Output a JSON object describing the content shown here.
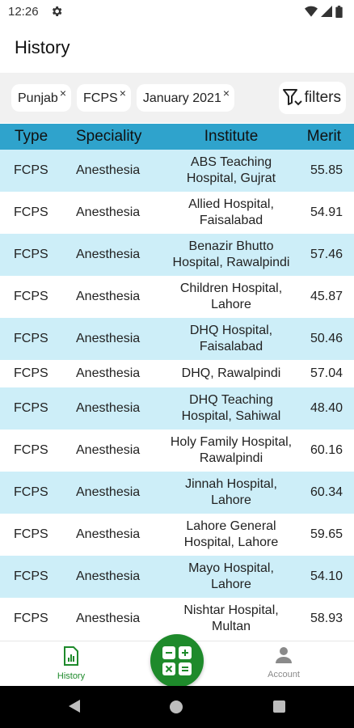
{
  "status_bar": {
    "time": "12:26"
  },
  "header": {
    "title": "History"
  },
  "filters": {
    "chips": [
      {
        "label": "Punjab",
        "remove": "×"
      },
      {
        "label": "FCPS",
        "remove": "×"
      },
      {
        "label": "January 2021",
        "remove": "×"
      }
    ],
    "button_label": "filters"
  },
  "table": {
    "headers": {
      "type": "Type",
      "speciality": "Speciality",
      "institute": "Institute",
      "merit": "Merit"
    },
    "rows": [
      {
        "type": "FCPS",
        "speciality": "Anesthesia",
        "institute_l1": "ABS Teaching",
        "institute_l2": "Hospital, Gujrat",
        "merit": "55.85"
      },
      {
        "type": "FCPS",
        "speciality": "Anesthesia",
        "institute_l1": "Allied Hospital,",
        "institute_l2": "Faisalabad",
        "merit": "54.91"
      },
      {
        "type": "FCPS",
        "speciality": "Anesthesia",
        "institute_l1": "Benazir Bhutto",
        "institute_l2": "Hospital, Rawalpindi",
        "merit": "57.46"
      },
      {
        "type": "FCPS",
        "speciality": "Anesthesia",
        "institute_l1": "Children Hospital,",
        "institute_l2": "Lahore",
        "merit": "45.87"
      },
      {
        "type": "FCPS",
        "speciality": "Anesthesia",
        "institute_l1": "DHQ Hospital,",
        "institute_l2": "Faisalabad",
        "merit": "50.46"
      },
      {
        "type": "FCPS",
        "speciality": "Anesthesia",
        "institute_l1": "DHQ, Rawalpindi",
        "institute_l2": "",
        "merit": "57.04"
      },
      {
        "type": "FCPS",
        "speciality": "Anesthesia",
        "institute_l1": "DHQ Teaching",
        "institute_l2": "Hospital, Sahiwal",
        "merit": "48.40"
      },
      {
        "type": "FCPS",
        "speciality": "Anesthesia",
        "institute_l1": "Holy Family Hospital,",
        "institute_l2": "Rawalpindi",
        "merit": "60.16"
      },
      {
        "type": "FCPS",
        "speciality": "Anesthesia",
        "institute_l1": "Jinnah Hospital,",
        "institute_l2": "Lahore",
        "merit": "60.34"
      },
      {
        "type": "FCPS",
        "speciality": "Anesthesia",
        "institute_l1": "Lahore General",
        "institute_l2": "Hospital, Lahore",
        "merit": "59.65"
      },
      {
        "type": "FCPS",
        "speciality": "Anesthesia",
        "institute_l1": "Mayo Hospital,",
        "institute_l2": "Lahore",
        "merit": "54.10"
      },
      {
        "type": "FCPS",
        "speciality": "Anesthesia",
        "institute_l1": "Nishtar Hospital,",
        "institute_l2": "Multan",
        "merit": "58.93"
      }
    ]
  },
  "bottom_nav": {
    "history_label": "History",
    "account_label": "Account",
    "fab_icon": "calculator-icon"
  },
  "colors": {
    "header_row": "#2fa3cc",
    "alt_row": "#cdeef8",
    "accent_green": "#1e8a2b"
  }
}
